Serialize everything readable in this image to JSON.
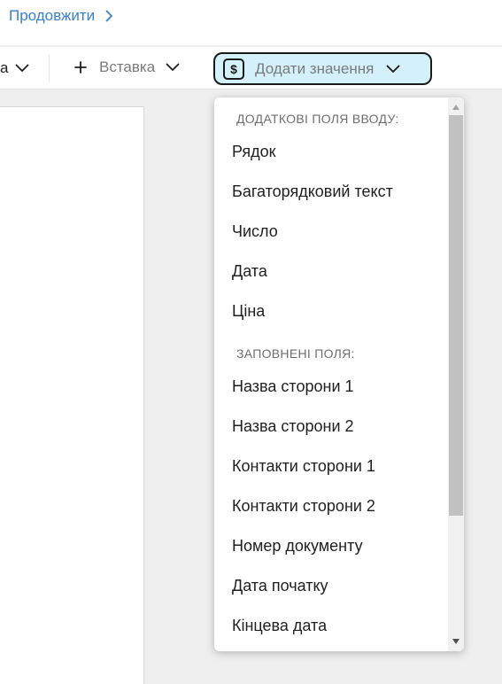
{
  "header": {
    "continue_label": "Продовжити"
  },
  "toolbar": {
    "cut_label": "а",
    "insert_label": "Вставка",
    "add_value_label": "Додати значення",
    "add_value_icon_glyph": "$"
  },
  "dropdown": {
    "section_extra_label": "ДОДАТКОВІ ПОЛЯ ВВОДУ:",
    "extra_items": [
      "Рядок",
      "Багаторядковий текст",
      "Число",
      "Дата",
      "Ціна"
    ],
    "section_filled_label": "ЗАПОВНЕНІ ПОЛЯ:",
    "filled_items": [
      "Назва сторони 1",
      "Назва сторони 2",
      "Контакти сторони 1",
      "Контакти сторони 2",
      "Номер документу",
      "Дата початку",
      "Кінцева дата"
    ]
  },
  "colors": {
    "link": "#3a7fd0",
    "add_value_bg": "#d3f0fb",
    "canvas_bg": "#efefef"
  },
  "icons": [
    "chevron-right-icon",
    "chevron-down-icon",
    "plus-icon",
    "dollar-icon",
    "scroll-up-arrow-icon",
    "scroll-down-arrow-icon"
  ]
}
